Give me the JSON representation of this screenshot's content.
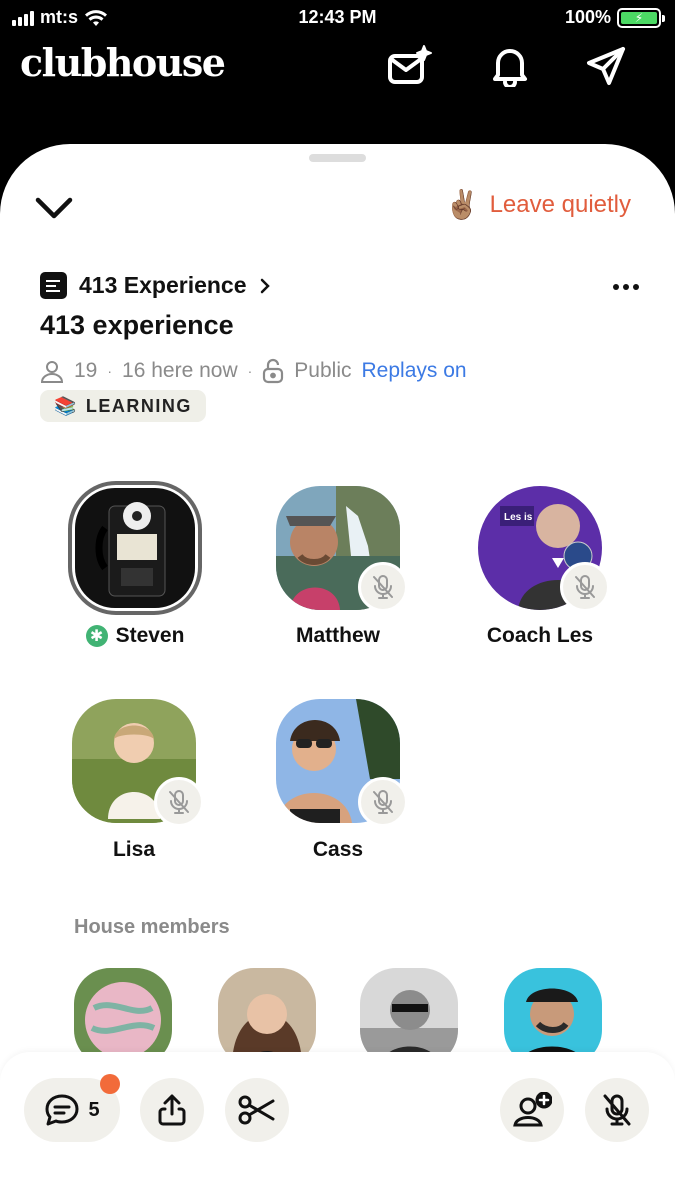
{
  "status_bar": {
    "carrier": "mt:s",
    "time": "12:43 PM",
    "battery": "100%"
  },
  "app": {
    "logo": "clubhouse"
  },
  "room": {
    "leave_label": "Leave quietly",
    "leave_emoji": "✌🏽",
    "club_name": "413 Experience",
    "title": "413 experience",
    "members_count": "19",
    "here_now": "16 here now",
    "visibility": "Public",
    "replays": "Replays on",
    "tag": {
      "emoji": "📚",
      "label": "LEARNING"
    }
  },
  "speakers": [
    {
      "name": "Steven",
      "moderator": true,
      "muted": false
    },
    {
      "name": "Matthew",
      "muted": true
    },
    {
      "name": "Coach Les",
      "muted": true
    },
    {
      "name": "Lisa",
      "muted": true
    },
    {
      "name": "Cass",
      "muted": true
    }
  ],
  "house_members_label": "House members",
  "bottom_bar": {
    "chat_count": "5"
  },
  "colors": {
    "accent_orange": "#e15d3d",
    "link_blue": "#3c7ae4",
    "moderator_green": "#41b374"
  }
}
